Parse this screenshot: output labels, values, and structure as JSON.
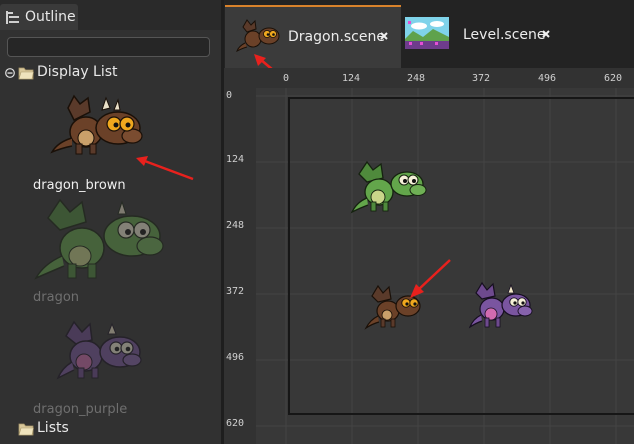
{
  "outline": {
    "tab_label": "Outline",
    "filter": {
      "value": "",
      "placeholder": ""
    },
    "display_list_label": "Display List",
    "items": [
      {
        "label": "dragon_brown",
        "state": "selected"
      },
      {
        "label": "dragon",
        "state": "dimmed"
      },
      {
        "label": "dragon_purple",
        "state": "dimmed"
      }
    ],
    "lists_label": "Lists"
  },
  "editor": {
    "tabs": [
      {
        "label": "Dragon.scene",
        "active": true
      },
      {
        "label": "Level.scene",
        "active": false
      }
    ],
    "ruler_top": [
      "0",
      "124",
      "248",
      "372",
      "496",
      "620"
    ],
    "ruler_left": [
      "0",
      "124",
      "248",
      "372",
      "496",
      "620"
    ]
  },
  "colors": {
    "accent": "#d9822b",
    "annotation_arrow": "#e8211d",
    "panel": "#313131",
    "viewport": "#383838"
  }
}
